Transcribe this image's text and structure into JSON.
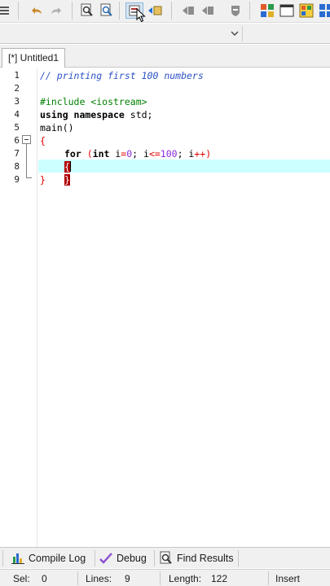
{
  "editor": {
    "tab_label": "[*] Untitled1",
    "line_numbers": [
      "1",
      "2",
      "3",
      "4",
      "5",
      "6",
      "7",
      "8",
      "9"
    ],
    "lines": {
      "l1_comment": "// printing first 100 numbers",
      "l3_include": "#include <iostream>",
      "l4_kw": "using namespace",
      "l4_rest": " std;",
      "l5": "main()",
      "l6": "{",
      "l7_for": "for",
      "l7_a": " (",
      "l7_int": "int",
      "l7_b": " i",
      "l7_eq": "=",
      "l7_zero": "0",
      "l7_c": "; i",
      "l7_le": "<=",
      "l7_hundred": "100",
      "l7_d": "; i",
      "l7_pp": "++",
      "l7_e": ")",
      "l8": "{",
      "l9_close": "}",
      "l9_brace": "}"
    }
  },
  "bottom_tabs": {
    "compile_log": "Compile Log",
    "debug": "Debug",
    "find_results": "Find Results"
  },
  "status": {
    "sel_label": "Sel:",
    "sel_value": "0",
    "lines_label": "Lines:",
    "lines_value": "9",
    "length_label": "Length:",
    "length_value": "122",
    "mode": "Insert"
  },
  "colors": {
    "current_line": "#ccffff",
    "comment": "#2b52c7",
    "preprocessor": "#008000",
    "brace_highlight": "#b00000"
  }
}
